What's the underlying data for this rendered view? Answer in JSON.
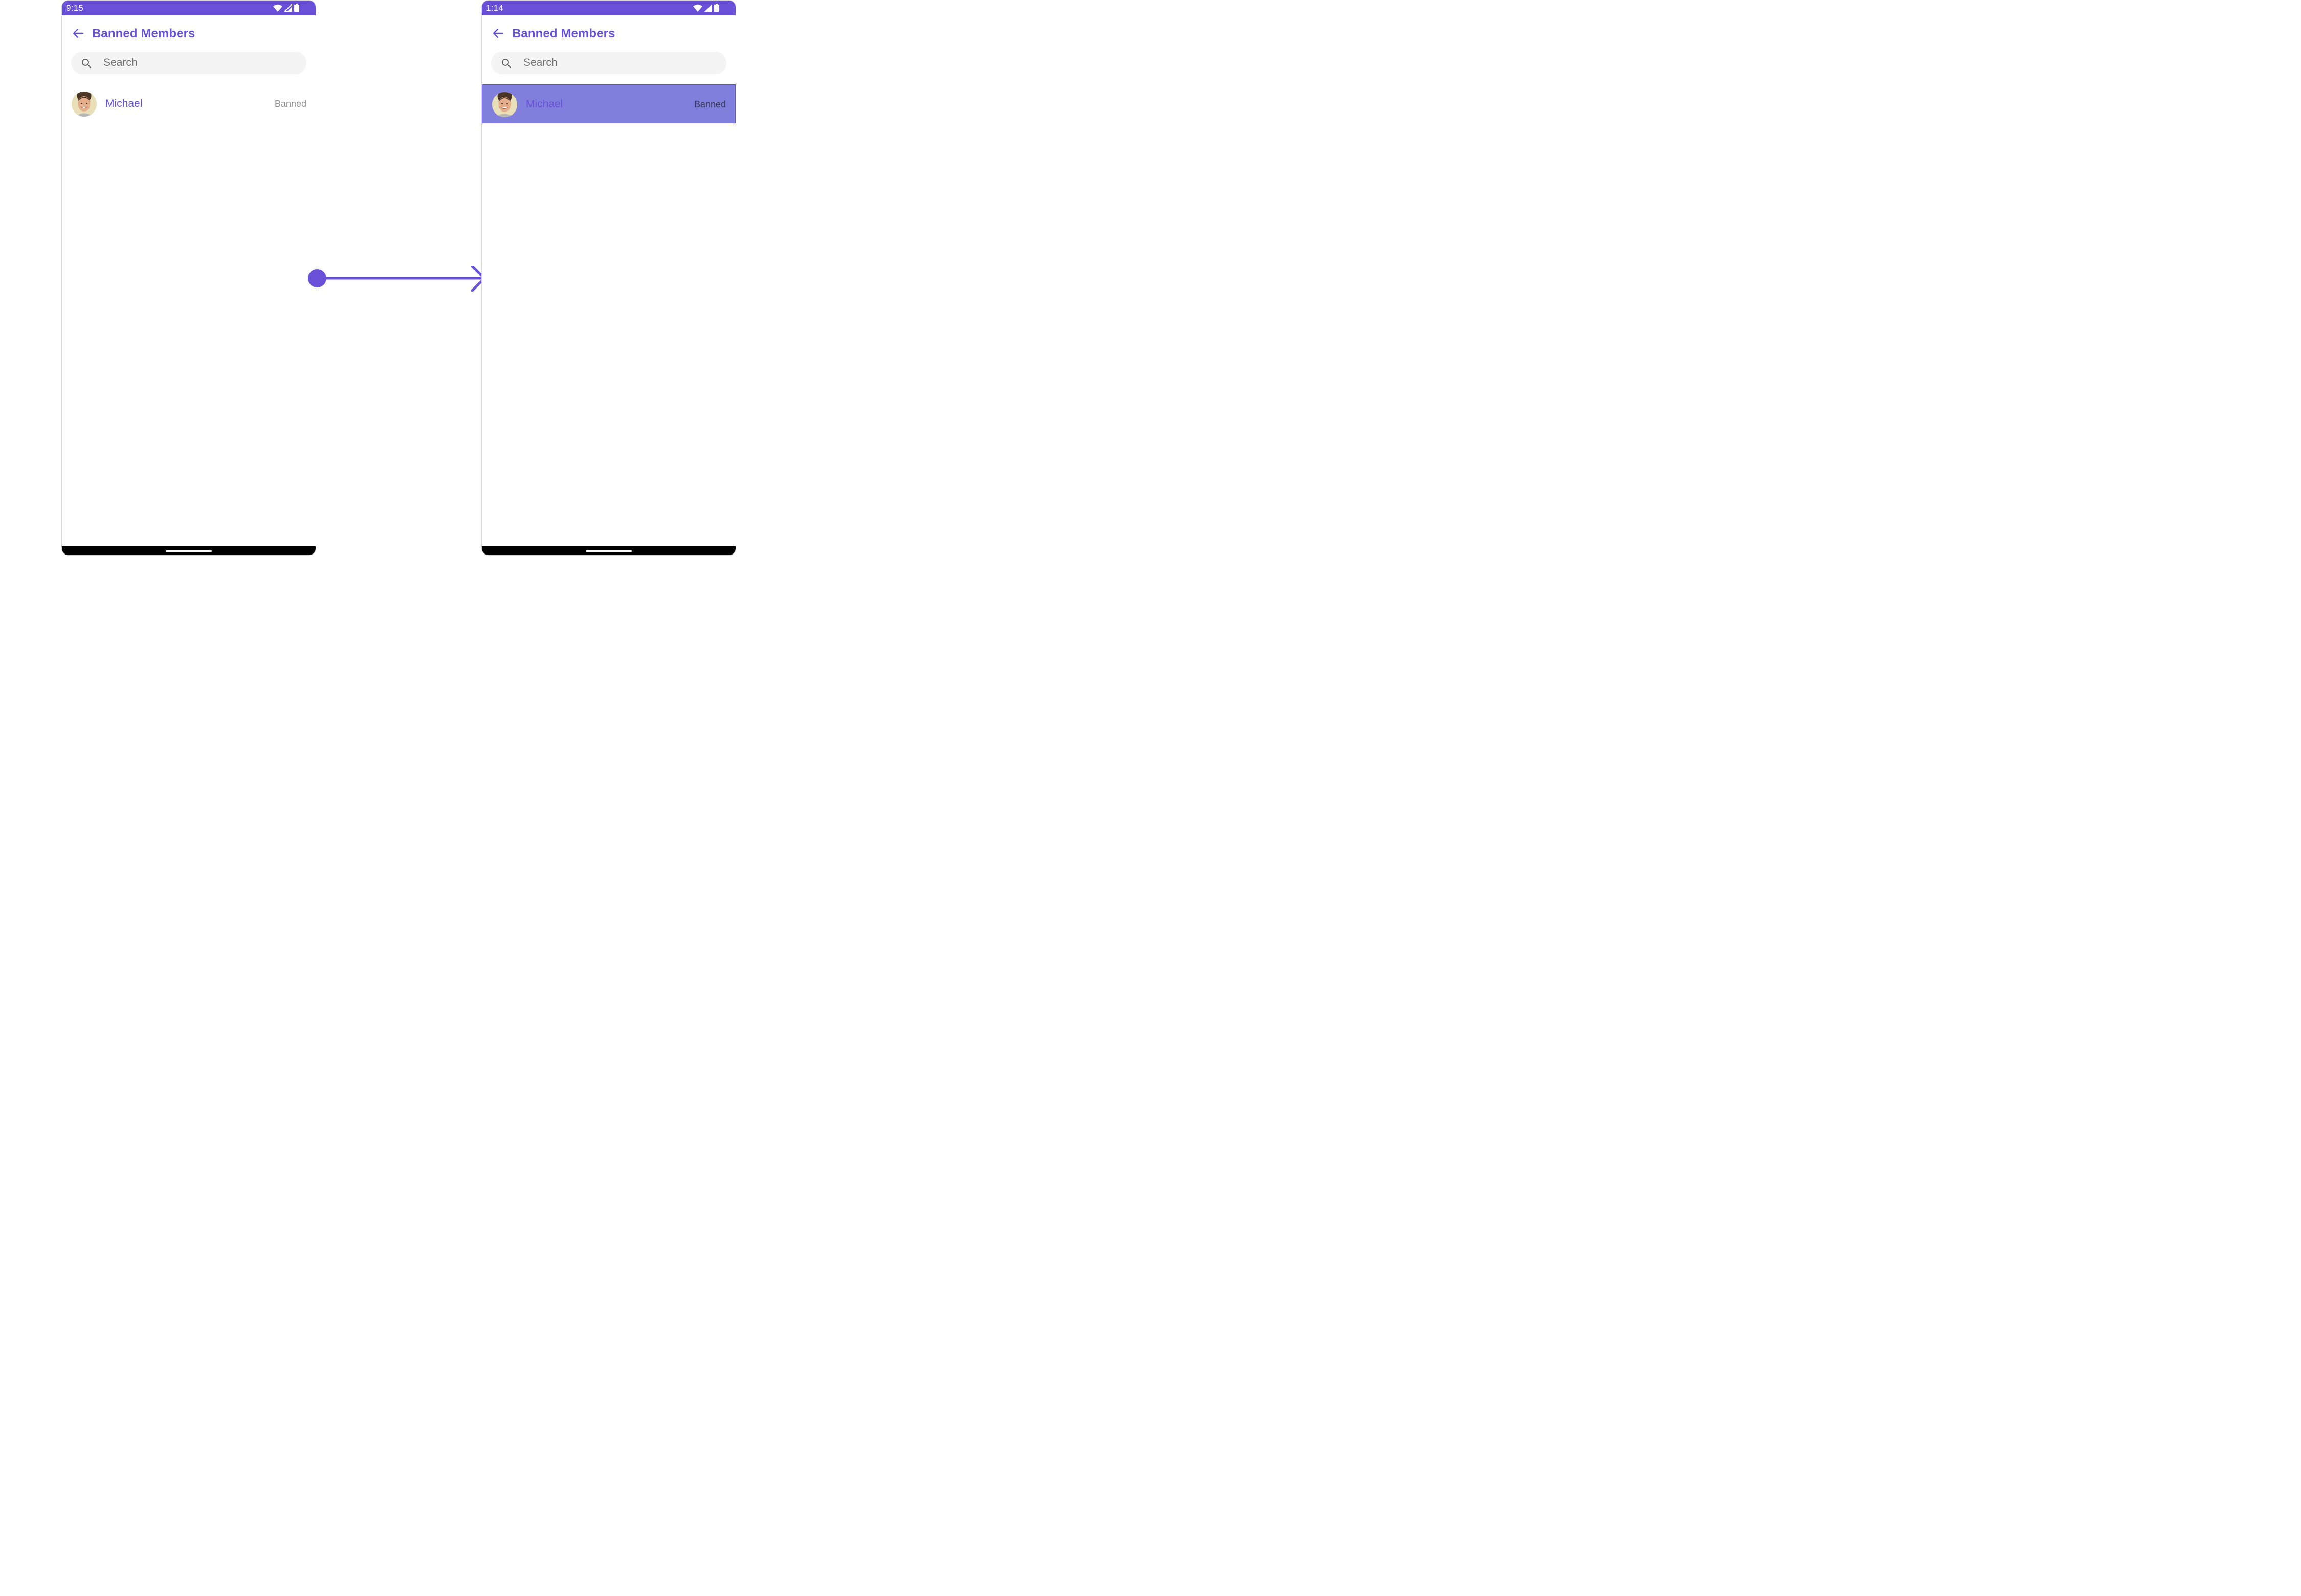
{
  "colors": {
    "accent": "#6851D6",
    "selected_row": "#8080DC",
    "search_bg": "#F4F4F4",
    "status_text": "#8B8B8B"
  },
  "screens": [
    {
      "state": "default",
      "status_bar": {
        "time": "9:15",
        "icons": [
          "wifi-icon",
          "cellular-signal-icon",
          "battery-icon"
        ]
      },
      "header": {
        "back_icon": "arrow-left-icon",
        "title": "Banned Members"
      },
      "search": {
        "icon": "search-icon",
        "placeholder": "Search",
        "value": ""
      },
      "members": [
        {
          "name": "Michael",
          "status": "Banned",
          "selected": false
        }
      ]
    },
    {
      "state": "selected",
      "status_bar": {
        "time": "1:14",
        "icons": [
          "wifi-icon",
          "cellular-signal-icon",
          "battery-icon"
        ]
      },
      "header": {
        "back_icon": "arrow-left-icon",
        "title": "Banned Members"
      },
      "search": {
        "icon": "search-icon",
        "placeholder": "Search",
        "value": ""
      },
      "members": [
        {
          "name": "Michael",
          "status": "Banned",
          "selected": true
        }
      ]
    }
  ],
  "transition": {
    "icon": "arrow-right-icon"
  }
}
